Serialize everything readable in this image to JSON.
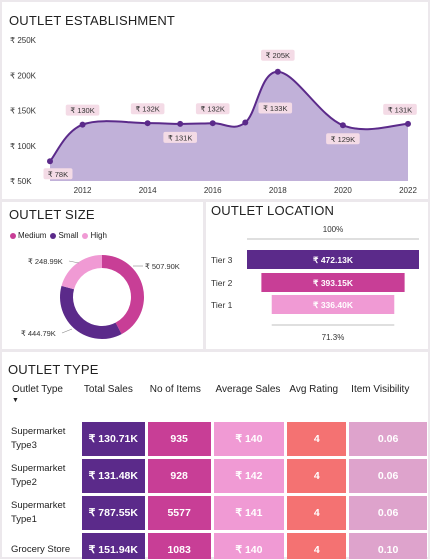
{
  "colors": {
    "area_fill": "#c1b1d9",
    "line": "#5b2a8a",
    "label_bg": "#f4dbe6",
    "medium": "#c83e96",
    "small": "#5b2a8a",
    "high": "#f09ad4",
    "tier3": "#5b2a8a",
    "tier2": "#c83e96",
    "tier1": "#f09ad4"
  },
  "establishment": {
    "title": "OUTLET ESTABLISHMENT",
    "point_labels": [
      "₹ 78K",
      "₹ 130K",
      "₹ 132K",
      "₹ 131K",
      "₹ 132K",
      "₹ 133K",
      "₹ 205K",
      "₹ 129K",
      "₹ 131K"
    ]
  },
  "size": {
    "title": "OUTLET SIZE",
    "legend": [
      "Medium",
      "Small",
      "High"
    ],
    "labels": [
      "₹ 507.90K",
      "₹ 444.79K",
      "₹ 248.99K"
    ]
  },
  "location": {
    "title": "OUTLET LOCATION",
    "top_pct": "100%",
    "bottom_pct": "71.3%",
    "tiers": [
      "Tier 3",
      "Tier 2",
      "Tier 1"
    ],
    "value_labels": [
      "₹ 472.13K",
      "₹ 393.15K",
      "₹ 336.40K"
    ]
  },
  "outlet_type": {
    "title": "OUTLET TYPE",
    "headers": [
      "Outlet Type",
      "Total Sales",
      "No of Items",
      "Average Sales",
      "Avg Rating",
      "Item Visibility"
    ],
    "rows": [
      {
        "type": "Supermarket Type3",
        "total_sales": "₹ 130.71K",
        "items": "935",
        "avg_sales": "₹ 140",
        "rating": "4",
        "visibility": "0.06"
      },
      {
        "type": "Supermarket Type2",
        "total_sales": "₹ 131.48K",
        "items": "928",
        "avg_sales": "₹ 142",
        "rating": "4",
        "visibility": "0.06"
      },
      {
        "type": "Supermarket Type1",
        "total_sales": "₹ 787.55K",
        "items": "5577",
        "avg_sales": "₹ 141",
        "rating": "4",
        "visibility": "0.06"
      },
      {
        "type": "Grocery Store",
        "total_sales": "₹ 151.94K",
        "items": "1083",
        "avg_sales": "₹ 140",
        "rating": "4",
        "visibility": "0.10"
      }
    ]
  },
  "chart_data": [
    {
      "type": "area",
      "title": "OUTLET ESTABLISHMENT",
      "x": [
        2011,
        2012,
        2014,
        2015,
        2016,
        2017,
        2018,
        2020,
        2022
      ],
      "values": [
        78,
        130,
        132,
        131,
        132,
        133,
        205,
        129,
        131
      ],
      "x_ticks": [
        "2012",
        "2014",
        "2016",
        "2018",
        "2020",
        "2022"
      ],
      "y_ticks": [
        "₹ 50K",
        "₹ 100K",
        "₹ 150K",
        "₹ 200K",
        "₹ 250K"
      ],
      "ylim": [
        50,
        250
      ],
      "xlim": [
        2011,
        2022
      ]
    },
    {
      "type": "pie",
      "title": "OUTLET SIZE",
      "categories": [
        "Medium",
        "Small",
        "High"
      ],
      "values": [
        507.9,
        444.79,
        248.99
      ],
      "legend": "top-left"
    },
    {
      "type": "bar",
      "title": "OUTLET LOCATION",
      "categories": [
        "Tier 3",
        "Tier 2",
        "Tier 1"
      ],
      "values": [
        472.13,
        393.15,
        336.4
      ]
    },
    {
      "type": "table",
      "title": "OUTLET TYPE",
      "columns": [
        "Outlet Type",
        "Total Sales",
        "No of Items",
        "Average Sales",
        "Avg Rating",
        "Item Visibility"
      ],
      "rows": [
        [
          "Supermarket Type3",
          "₹ 130.71K",
          "935",
          "₹ 140",
          "4",
          "0.06"
        ],
        [
          "Supermarket Type2",
          "₹ 131.48K",
          "928",
          "₹ 142",
          "4",
          "0.06"
        ],
        [
          "Supermarket Type1",
          "₹ 787.55K",
          "5577",
          "₹ 141",
          "4",
          "0.06"
        ],
        [
          "Grocery Store",
          "₹ 151.94K",
          "1083",
          "₹ 140",
          "4",
          "0.10"
        ]
      ]
    }
  ]
}
